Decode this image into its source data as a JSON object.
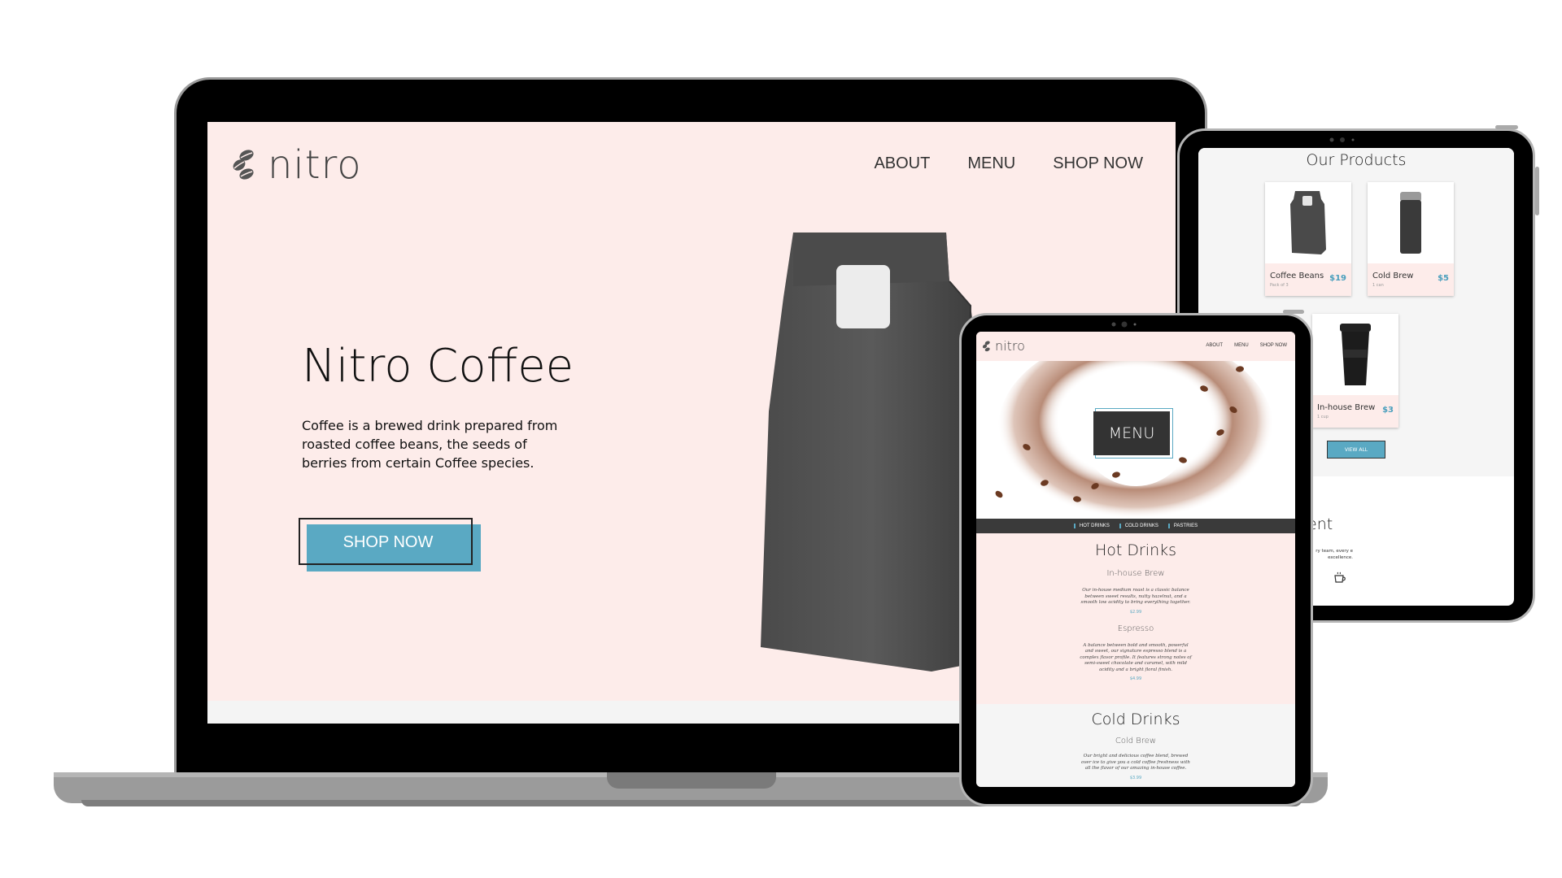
{
  "laptop_site": {
    "logo_text": "nitro",
    "nav": [
      "ABOUT",
      "MENU",
      "SHOP NOW"
    ],
    "hero_title": "Nitro Coffee",
    "hero_text": "Coffee is a brewed drink prepared from roasted coffee beans, the seeds of berries from certain Coffee species.",
    "cta_label": "SHOP NOW"
  },
  "products_tablet": {
    "title": "Our Products",
    "products": [
      {
        "name": "Coffee Beans",
        "sub": "Pack of 3",
        "price": "$19"
      },
      {
        "name": "Cold Brew",
        "sub": "1 can",
        "price": "$5"
      },
      {
        "name": "In-house Brew",
        "sub": "1 cup",
        "price": "$3"
      }
    ],
    "view_all_label": "VIEW ALL",
    "fragment_title": "ent",
    "fragment_text": "ry team, every e excellence."
  },
  "menu_tablet": {
    "logo_text": "nitro",
    "nav": [
      "ABOUT",
      "MENU",
      "SHOP NOW"
    ],
    "menu_button_label": "MENU",
    "categories": [
      "HOT DRINKS",
      "COLD DRINKS",
      "PASTRIES"
    ],
    "hot_section": {
      "title": "Hot Drinks",
      "items": [
        {
          "name": "In-house Brew",
          "desc": "Our in-house medium roast is a classic balance between sweet results, nutty hazelnut, and a smooth low acidity to bring everything together.",
          "price": "$2.99"
        },
        {
          "name": "Espresso",
          "desc": "A balance between bold and smooth, powerful and sweet, our signature espresso blend is a complex flavor profile. It features strong notes of semi-sweet chocolate and caramel, with mild acidity and a bright floral finish.",
          "price": "$4.99"
        }
      ]
    },
    "cold_section": {
      "title": "Cold Drinks",
      "items": [
        {
          "name": "Cold Brew",
          "desc": "Our bright and delicious coffee blend, brewed over ice to give you a cold coffee freshness with all the flavor of our amazing in-house coffee.",
          "price": "$3.99"
        }
      ]
    }
  },
  "colors": {
    "accent": "#5aa9c3",
    "page_pink": "#fdecea",
    "dark_gray": "#333333"
  },
  "icons": [
    "beans-logo-icon",
    "coffee-cup-icon",
    "coffee-bag-icon",
    "cold-brew-can-icon",
    "coffee-cup-product-icon"
  ]
}
